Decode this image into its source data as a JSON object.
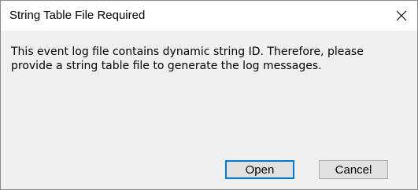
{
  "window": {
    "title": "String Table File Required",
    "close_icon": "close-icon"
  },
  "message": {
    "line1": "This event log file contains dynamic string ID. Therefore, please",
    "line2": "provide a string table file to generate the log messages."
  },
  "buttons": {
    "open_label": "Open",
    "cancel_label": "Cancel"
  },
  "colors": {
    "dialog_background": "#f0f0f0",
    "titlebar_background": "#ffffff",
    "default_button_border": "#0078d7",
    "button_background": "#e1e1e1"
  }
}
